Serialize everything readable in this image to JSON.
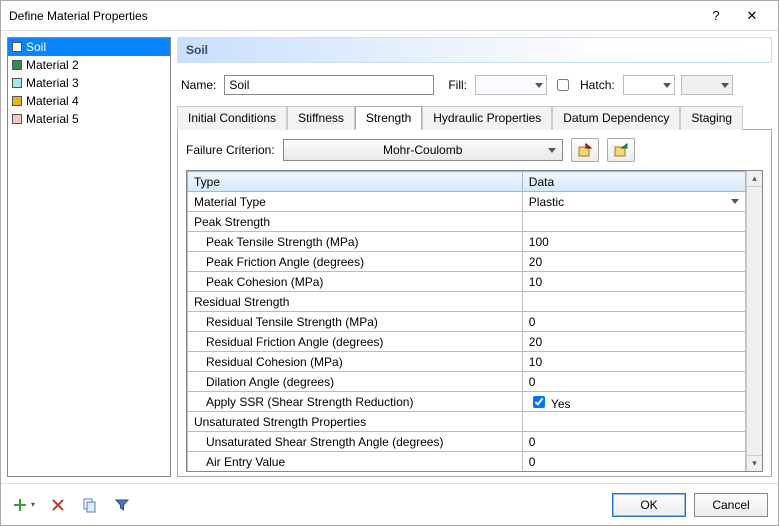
{
  "window": {
    "title": "Define Material Properties",
    "help": "?",
    "close": "✕"
  },
  "materials": [
    {
      "name": "Soil",
      "color": "#ffffff",
      "selected": true
    },
    {
      "name": "Material 2",
      "color": "#2e8b57",
      "selected": false
    },
    {
      "name": "Material 3",
      "color": "#a7e7ef",
      "selected": false
    },
    {
      "name": "Material 4",
      "color": "#f0b01c",
      "selected": false
    },
    {
      "name": "Material 5",
      "color": "#f3c9c9",
      "selected": false
    }
  ],
  "header": {
    "material_name": "Soil"
  },
  "form": {
    "name_label": "Name:",
    "name_value": "Soil",
    "fill_label": "Fill:",
    "hatch_label": "Hatch:"
  },
  "tabs": {
    "items": [
      "Initial Conditions",
      "Stiffness",
      "Strength",
      "Hydraulic Properties",
      "Datum Dependency",
      "Staging"
    ],
    "active_index": 2
  },
  "criterion": {
    "label": "Failure Criterion:",
    "value": "Mohr-Coulomb"
  },
  "grid": {
    "headers": {
      "type": "Type",
      "data": "Data"
    },
    "rows": [
      {
        "kind": "combo",
        "indent": 0,
        "label": "Material Type",
        "value": "Plastic"
      },
      {
        "kind": "group",
        "indent": 0,
        "label": "Peak Strength"
      },
      {
        "kind": "value",
        "indent": 1,
        "label": "Peak Tensile Strength (MPa)",
        "value": "100"
      },
      {
        "kind": "value",
        "indent": 1,
        "label": "Peak Friction Angle (degrees)",
        "value": "20"
      },
      {
        "kind": "value",
        "indent": 1,
        "label": "Peak Cohesion (MPa)",
        "value": "10"
      },
      {
        "kind": "group",
        "indent": 0,
        "label": "Residual Strength"
      },
      {
        "kind": "value",
        "indent": 1,
        "label": "Residual Tensile Strength (MPa)",
        "value": "0"
      },
      {
        "kind": "value",
        "indent": 1,
        "label": "Residual Friction Angle (degrees)",
        "value": "20"
      },
      {
        "kind": "value",
        "indent": 1,
        "label": "Residual Cohesion (MPa)",
        "value": "10"
      },
      {
        "kind": "value",
        "indent": 1,
        "label": "Dilation Angle (degrees)",
        "value": "0"
      },
      {
        "kind": "check",
        "indent": 1,
        "label": "Apply SSR (Shear Strength Reduction)",
        "value": "Yes",
        "checked": true
      },
      {
        "kind": "group",
        "indent": 0,
        "label": "Unsaturated Strength Properties"
      },
      {
        "kind": "value",
        "indent": 1,
        "label": "Unsaturated Shear Strength Angle (degrees)",
        "value": "0"
      },
      {
        "kind": "value",
        "indent": 1,
        "label": "Air Entry Value",
        "value": "0"
      }
    ]
  },
  "footer": {
    "ok": "OK",
    "cancel": "Cancel"
  },
  "toolbar_icons": {
    "add": "add-icon",
    "delete": "delete-icon",
    "copy": "copy-icon",
    "filter": "filter-icon",
    "import": "import-icon",
    "export": "export-icon"
  }
}
